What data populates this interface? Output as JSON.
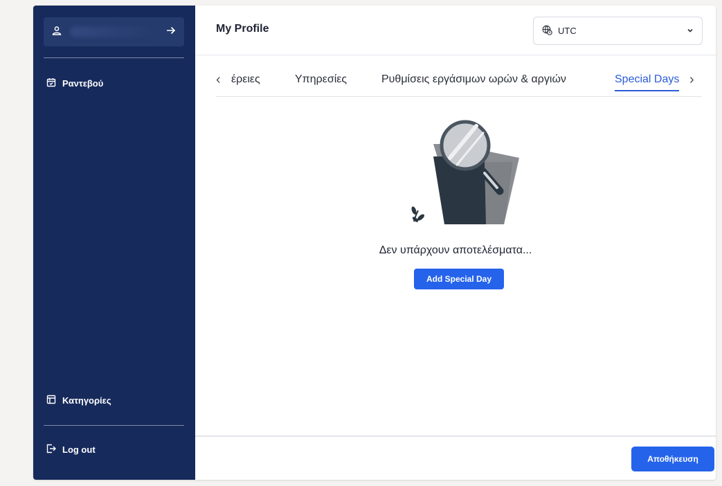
{
  "sidebar": {
    "user_card": {
      "icon": "user-icon",
      "arrow_icon": "arrow-right-icon"
    },
    "top_items": [
      {
        "label": "Ραντεβού",
        "icon": "calendar-icon"
      }
    ],
    "bottom_items": [
      {
        "label": "Κατηγορίες",
        "icon": "layout-icon"
      }
    ],
    "logout": {
      "label": "Log out",
      "icon": "logout-icon"
    }
  },
  "header": {
    "title": "My Profile",
    "timezone": {
      "value": "UTC",
      "icon": "globe-clock-icon",
      "caret_icon": "chevron-down-icon"
    }
  },
  "tabs": {
    "prev_arrow": "‹",
    "next_arrow": "›",
    "items": [
      {
        "label": "έρειες",
        "active": false
      },
      {
        "label": "Υπηρεσίες",
        "active": false
      },
      {
        "label": "Ρυθμίσεις εργάσιμων ωρών & αργιών",
        "active": false
      },
      {
        "label": "Special Days",
        "active": true
      }
    ]
  },
  "empty_state": {
    "illustration": "folder-magnifier-illustration",
    "message": "Δεν υπάρχουν αποτελέσματα...",
    "button_label": "Add Special Day"
  },
  "footer": {
    "save_label": "Αποθήκευση"
  },
  "colors": {
    "sidebar_bg": "#172a5c",
    "accent": "#2563eb",
    "active_tab": "#2a5bd7"
  }
}
